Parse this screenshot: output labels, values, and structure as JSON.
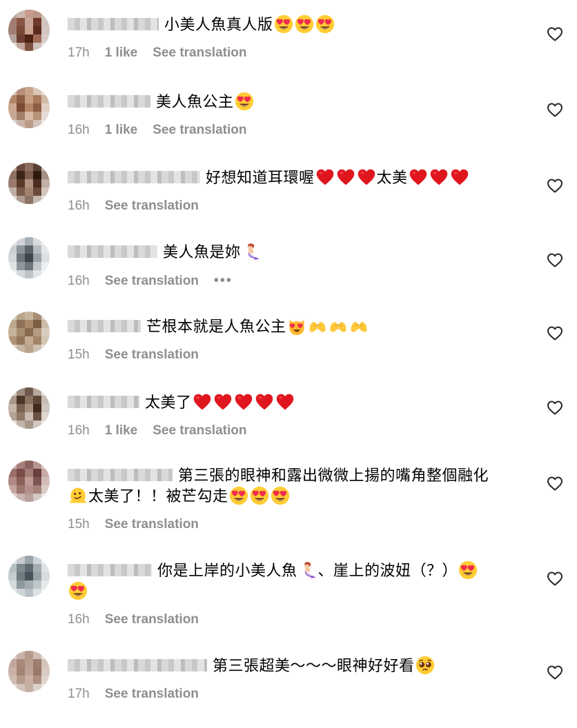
{
  "comments": [
    {
      "username_width": 132,
      "text_before": "小美人魚真人版",
      "emojis_after": [
        "heart-eyes",
        "heart-eyes",
        "heart-eyes"
      ],
      "time": "17h",
      "likes": "1 like",
      "translation": "See translation",
      "avatar": [
        "#b9a69f",
        "#cbb8b0",
        "#c89b8c",
        "#b99889",
        "#d5c7c0",
        "#a47e70",
        "#8a5443",
        "#c8a59a",
        "#6f3a2b",
        "#cfc3bc",
        "#9f7f74",
        "#7a4a36",
        "#c9a191",
        "#5b2b1e",
        "#d3c6c1",
        "#b3a39c",
        "#6c3d31",
        "#4e2115",
        "#a06a57",
        "#d7ccc7",
        "#e2dbd8",
        "#c2a89e",
        "#7f4f3f",
        "#d0c3bd",
        "#e5e0de"
      ]
    },
    {
      "username_width": 120,
      "text_before": "美人魚公主",
      "emojis_after": [
        "heart-eyes"
      ],
      "time": "16h",
      "likes": "1 like",
      "translation": "See translation",
      "avatar": [
        "#d5c3b3",
        "#b58f77",
        "#c8a48c",
        "#d8c5b7",
        "#e1d7cf",
        "#b2876b",
        "#8c5d41",
        "#c99d7f",
        "#a9795b",
        "#d2b8a5",
        "#cda790",
        "#7a4c33",
        "#b68668",
        "#8d5f45",
        "#e2d2c4",
        "#c6a894",
        "#a17f69",
        "#d6b9a4",
        "#b7937a",
        "#e6dcd5",
        "#dcd2cc",
        "#c9b5a8",
        "#b99b87",
        "#d3c5bb",
        "#ebe6e2"
      ]
    },
    {
      "username_width": 192,
      "text_before": "好想知道耳環喔",
      "emojis_after": [
        "red-heart",
        "red-heart",
        "red-heart"
      ],
      "text_middle": "太美",
      "emojis_end": [
        "red-heart",
        "red-heart",
        "red-heart"
      ],
      "time": "16h",
      "translation": "See translation",
      "avatar": [
        "#b8a49a",
        "#6a4b3d",
        "#8f6d5f",
        "#5b4034",
        "#c7b7ae",
        "#8d7062",
        "#3d2419",
        "#7d5c4c",
        "#2f1a11",
        "#a68f83",
        "#9b7c6c",
        "#5a3a2b",
        "#b09280",
        "#4a2e22",
        "#c3b1a6",
        "#c0aea3",
        "#7a5a4a",
        "#a2826f",
        "#6a4a3a",
        "#d4c7bf",
        "#dcd3ce",
        "#b09c90",
        "#8c7365",
        "#c7b8af",
        "#e4ddd9"
      ]
    },
    {
      "username_width": 130,
      "text_before": "美人魚是妳",
      "emojis_after": [
        "mermaid"
      ],
      "time": "16h",
      "translation": "See translation",
      "more": "•••",
      "avatar": [
        "#e2e4e6",
        "#cfd3d7",
        "#a7aeb4",
        "#d8dcdf",
        "#eef0f1",
        "#c9ced2",
        "#8e969d",
        "#5c636a",
        "#b6bcc1",
        "#e3e6e8",
        "#d2d6d9",
        "#6d747b",
        "#3e454b",
        "#9aa1a7",
        "#dde0e3",
        "#e0e3e5",
        "#8f979e",
        "#6f777e",
        "#c4c9cd",
        "#eceef0",
        "#eef0f1",
        "#d4d8db",
        "#bcc2c6",
        "#e1e4e6",
        "#f3f4f5"
      ]
    },
    {
      "username_width": 106,
      "text_before": "芒根本就是人魚公主",
      "emojis_after": [
        "smiling-cat-heart-eyes",
        "heart-hands",
        "heart-hands",
        "heart-hands"
      ],
      "time": "15h",
      "translation": "See translation",
      "avatar": [
        "#d6ccbf",
        "#b9a48c",
        "#c7b59d",
        "#a58d73",
        "#ddd4c9",
        "#bda78e",
        "#8f7257",
        "#a9896a",
        "#7c5f45",
        "#cbbba7",
        "#c8b49c",
        "#a88c70",
        "#8a6a4e",
        "#b39a80",
        "#d9cdbf",
        "#b09478",
        "#947658",
        "#c4ad92",
        "#a38669",
        "#d3c5b4",
        "#dbd2c7",
        "#c6b5a1",
        "#b8a18a",
        "#d0c2b1",
        "#e6e0d9"
      ]
    },
    {
      "username_width": 104,
      "text_before": "太美了",
      "emojis_after": [
        "red-heart",
        "red-heart",
        "red-heart",
        "red-heart",
        "red-heart"
      ],
      "time": "16h",
      "likes": "1 like",
      "translation": "See translation",
      "avatar": [
        "#d8d2cc",
        "#9c8b7e",
        "#6e5a4c",
        "#b7a89c",
        "#e1dcd7",
        "#a9978a",
        "#4c3628",
        "#8a7260",
        "#5d4636",
        "#c8bdb4",
        "#c4b6ab",
        "#7a6252",
        "#a58f7e",
        "#3f2a1d",
        "#d0c6be",
        "#b3a396",
        "#8e7867",
        "#cbbcb0",
        "#6a5242",
        "#ddd5cf",
        "#e5e1dd",
        "#c1b5ab",
        "#a79789",
        "#d2c8c0",
        "#ece9e6"
      ]
    },
    {
      "username_width": 152,
      "text_before": "第三張的眼神和露出微微上揚的嘴角整個融化",
      "line2_emojis": [
        "melting-face"
      ],
      "line2_text": "太美了！！被芒勾走",
      "emojis_end": [
        "heart-eyes",
        "heart-eyes",
        "heart-eyes"
      ],
      "time": "15h",
      "translation": "See translation",
      "avatar": [
        "#c9b2ae",
        "#a7807b",
        "#8c625e",
        "#b9958f",
        "#d9c9c6",
        "#9a6e69",
        "#7b4c48",
        "#a57d77",
        "#6b403c",
        "#c7aaa5",
        "#b08a85",
        "#8a5f5a",
        "#c09b95",
        "#7e5450",
        "#d3bdb9",
        "#c4a6a1",
        "#9d7670",
        "#b48f89",
        "#a5827c",
        "#dacbc8",
        "#e2d7d5",
        "#cab4b0",
        "#b8a09b",
        "#d6c8c5",
        "#ece5e4"
      ]
    },
    {
      "username_width": 122,
      "text_before": "你是上岸的小美人魚",
      "emojis_after": [
        "mermaid"
      ],
      "text_middle": "、崖上的波妞（？）",
      "emojis_end": [
        "heart-eyes"
      ],
      "line2_emojis": [
        "heart-eyes"
      ],
      "time": "16h",
      "translation": "See translation",
      "avatar": [
        "#dfe3e5",
        "#c5cbce",
        "#9aa4a9",
        "#cdd3d6",
        "#eceff0",
        "#b6bfc3",
        "#7e8a90",
        "#5e6b71",
        "#a3adb2",
        "#dfe3e5",
        "#c6cdd0",
        "#6f7c82",
        "#46535a",
        "#98a3a8",
        "#d7dcdf",
        "#d4d9dc",
        "#8d989e",
        "#a2adb2",
        "#bec6ca",
        "#e6e9ea",
        "#e9ecee",
        "#cfd5d8",
        "#b9c1c5",
        "#dde1e3",
        "#f1f3f4"
      ]
    },
    {
      "username_width": 202,
      "text_before": "第三張超美～～～眼神好好看",
      "emojis_after": [
        "pleading-face"
      ],
      "time": "17h",
      "translation": "See translation",
      "avatar": [
        "#e0d5cf",
        "#c8b3a8",
        "#b69b8d",
        "#cfbcb1",
        "#e8e0dc",
        "#c1a89a",
        "#a8897a",
        "#b99e90",
        "#9d7e6f",
        "#d4c3ba",
        "#c9b2a6",
        "#a38375",
        "#bda396",
        "#987868",
        "#d9cbc3",
        "#d0bdb2",
        "#b59a8c",
        "#c7afa2",
        "#ad9081",
        "#e0d4cd",
        "#e7dfda",
        "#d3c3ba",
        "#c5b0a4",
        "#ddd0c9",
        "#efe9e6"
      ]
    }
  ]
}
